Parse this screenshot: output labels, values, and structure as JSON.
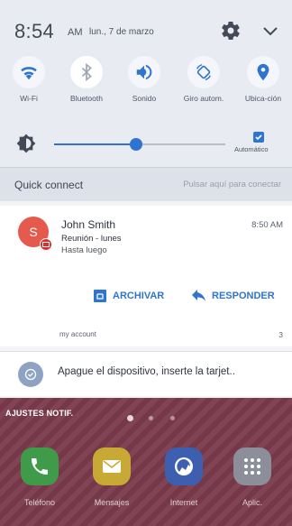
{
  "status": {
    "time": "8:54",
    "ampm": "AM",
    "date": "lun., 7 de marzo"
  },
  "quick_panel": {
    "toggles": [
      {
        "label": "Wi-Fi",
        "icon": "wifi-icon",
        "on": true
      },
      {
        "label": "Bluetooth",
        "icon": "bluetooth-icon",
        "on": false
      },
      {
        "label": "Sonido",
        "icon": "sound-icon",
        "on": true
      },
      {
        "label": "Giro autom.",
        "icon": "rotate-icon",
        "on": true
      },
      {
        "label": "Ubica-ción",
        "icon": "location-icon",
        "on": true
      }
    ],
    "brightness": {
      "level": 0.48,
      "auto_label": "Automático",
      "auto_checked": true
    },
    "accent_color": "#2f74cf"
  },
  "quick_connect": {
    "title": "Quick connect",
    "hint": "Pulsar aquí para conectar"
  },
  "notification": {
    "avatar_letter": "S",
    "sender": "John Smith",
    "time": "8:50 AM",
    "subject": "Reunión - lunes",
    "preview": "Hasta luego",
    "archive_label": "ARCHIVAR",
    "reply_label": "RESPONDER",
    "account": "my account",
    "count": "3"
  },
  "notification2": {
    "text": "Apague el dispositivo, inserte la tarjet.."
  },
  "home": {
    "settings_label": "AJUSTES NOTIF.",
    "apps": [
      {
        "label": "Teléfono",
        "icon": "phone-icon",
        "color": "#3f9a4a"
      },
      {
        "label": "Mensajes",
        "icon": "messages-icon",
        "color": "#c9a935"
      },
      {
        "label": "Internet",
        "icon": "internet-icon",
        "color": "#3d5fb0"
      },
      {
        "label": "Aplic.",
        "icon": "apps-icon",
        "color": "#8c8f99"
      }
    ]
  }
}
